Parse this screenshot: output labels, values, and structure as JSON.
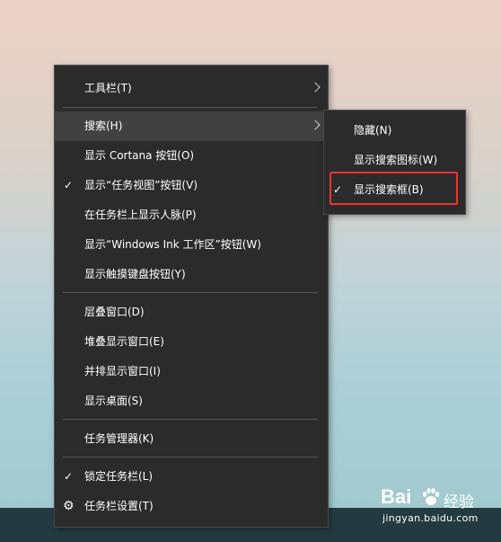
{
  "main_menu": {
    "items": [
      {
        "label": "工具栏(T)",
        "submenu": true
      },
      {
        "label": "搜索(H)",
        "submenu": true,
        "highlighted": true
      },
      {
        "label": "显示 Cortana 按钮(O)"
      },
      {
        "label": "显示“任务视图”按钮(V)",
        "checked": true
      },
      {
        "label": "在任务栏上显示人脉(P)"
      },
      {
        "label": "显示“Windows Ink 工作区”按钮(W)"
      },
      {
        "label": "显示触摸键盘按钮(Y)"
      },
      {
        "label": "层叠窗口(D)"
      },
      {
        "label": "堆叠显示窗口(E)"
      },
      {
        "label": "并排显示窗口(I)"
      },
      {
        "label": "显示桌面(S)"
      },
      {
        "label": "任务管理器(K)"
      },
      {
        "label": "锁定任务栏(L)",
        "checked": true
      },
      {
        "label": "任务栏设置(T)",
        "icon": "gear-icon"
      }
    ]
  },
  "sub_menu": {
    "items": [
      {
        "label": "隐藏(N)"
      },
      {
        "label": "显示搜索图标(W)"
      },
      {
        "label": "显示搜索框(B)",
        "checked": true
      }
    ]
  },
  "glyphs": {
    "check": "✓",
    "gear": "⚙"
  },
  "colors": {
    "menu_bg": "#2b2b2b",
    "highlight_bg": "#414141",
    "annotation": "#e8362f",
    "taskbar": "#233b40"
  },
  "watermark": {
    "logo_text": "Bai",
    "cn_text": "经验",
    "url": "jingyan.baidu.com"
  }
}
